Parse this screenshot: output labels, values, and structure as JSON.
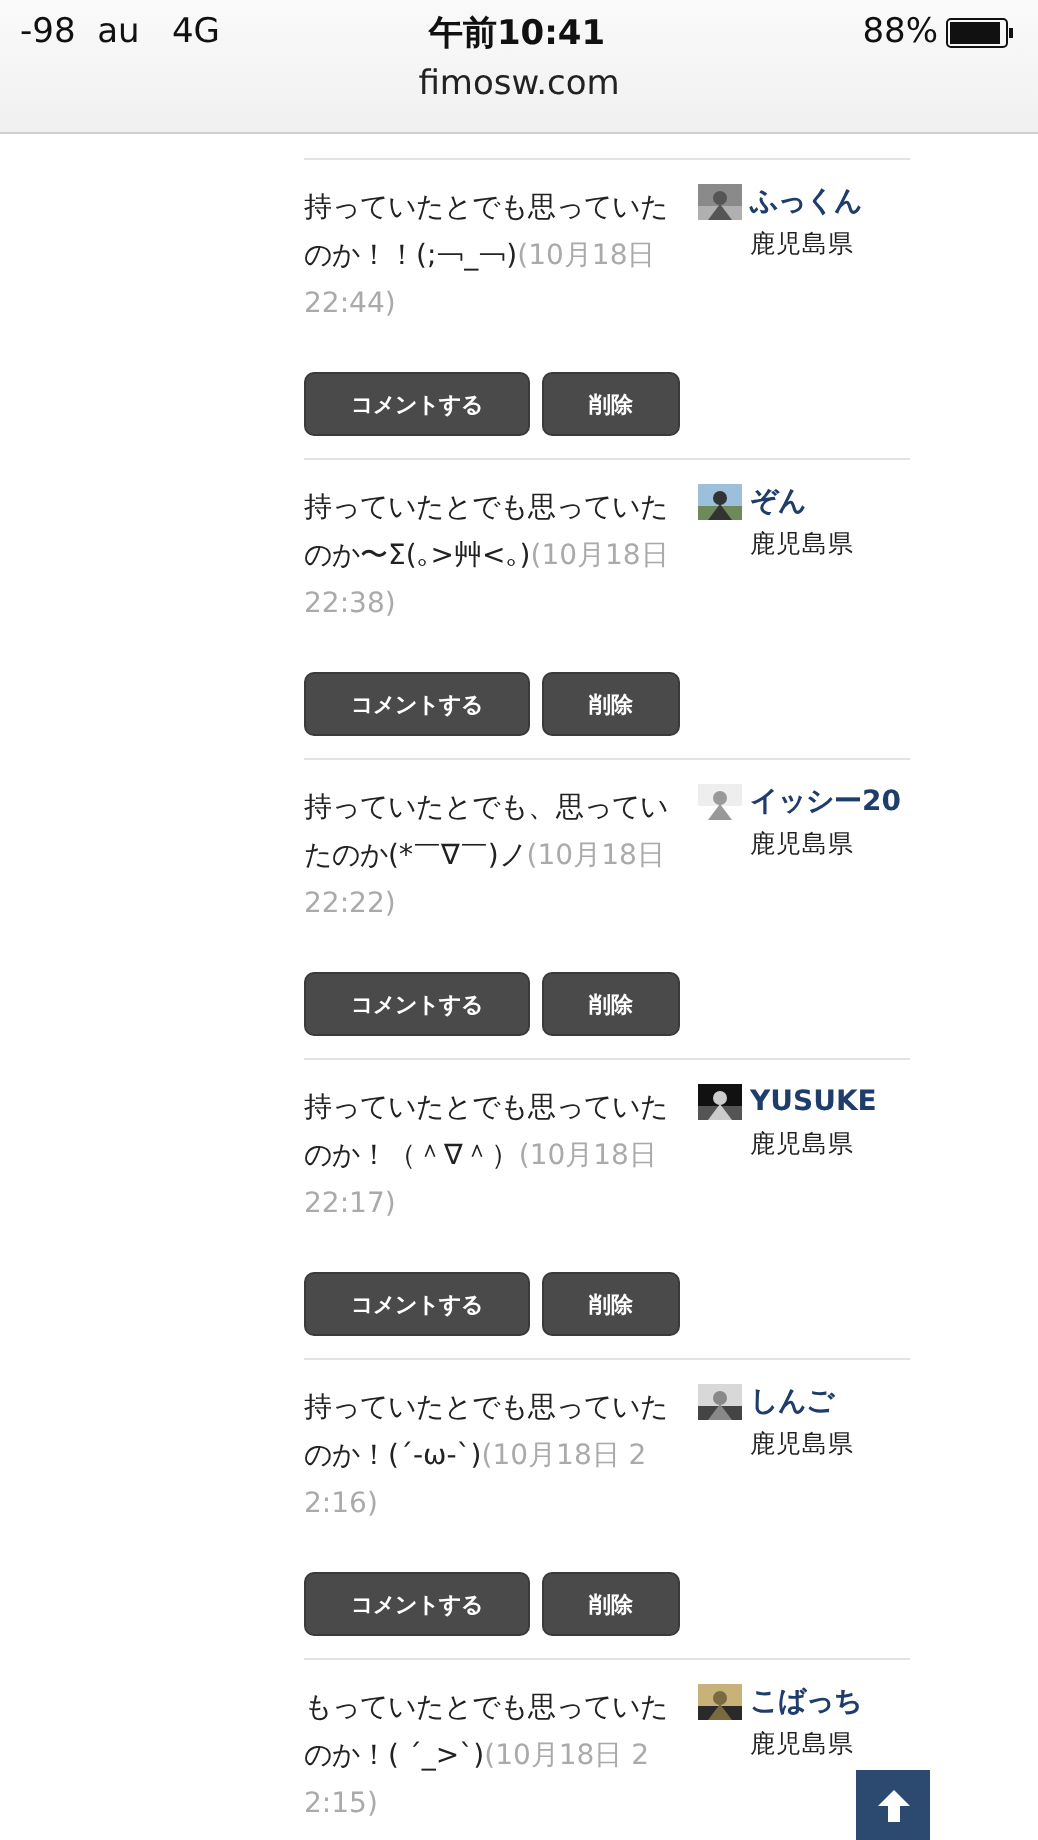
{
  "status_bar": {
    "carrier": "-98  au   4G",
    "time": "午前10:41",
    "battery": "88%"
  },
  "address_bar": {
    "url": "fimosw.com"
  },
  "comments": [
    {
      "text": "持っていたとでも思っていたのか！！(;￢_￢)",
      "time": "(10月18日 22:44)",
      "user": "ふっくん",
      "prefecture": "鹿児島県",
      "actions": [
        "コメントする",
        "削除"
      ]
    },
    {
      "text": "持っていたとでも思っていたのか〜Σ(｡>艸<｡)",
      "time": "(10月18日 22:38)",
      "user": "ぞん",
      "prefecture": "鹿児島県",
      "actions": [
        "コメントする",
        "削除"
      ]
    },
    {
      "text": "持っていたとでも、思っていたのか(*￣∇￣)ノ",
      "time": "(10月18日 22:22)",
      "user": "イッシー20",
      "prefecture": "鹿児島県",
      "actions": [
        "コメントする",
        "削除"
      ]
    },
    {
      "text": "持っていたとでも思っていたのか！（＾∇＾）",
      "time": "(10月18日 22:17)",
      "user": "YUSUKE",
      "prefecture": "鹿児島県",
      "actions": [
        "コメントする",
        "削除"
      ]
    },
    {
      "text": "持っていたとでも思っていたのか！(´-ω-`)",
      "time": "(10月18日 22:16)",
      "user": "しんご",
      "prefecture": "鹿児島県",
      "actions": [
        "コメントする",
        "削除"
      ]
    },
    {
      "text": "もっていたとでも思っていたのか！( ´_>`)",
      "time": "(10月18日 22:15)",
      "user": "こばっち",
      "prefecture": "鹿児島県"
    }
  ]
}
